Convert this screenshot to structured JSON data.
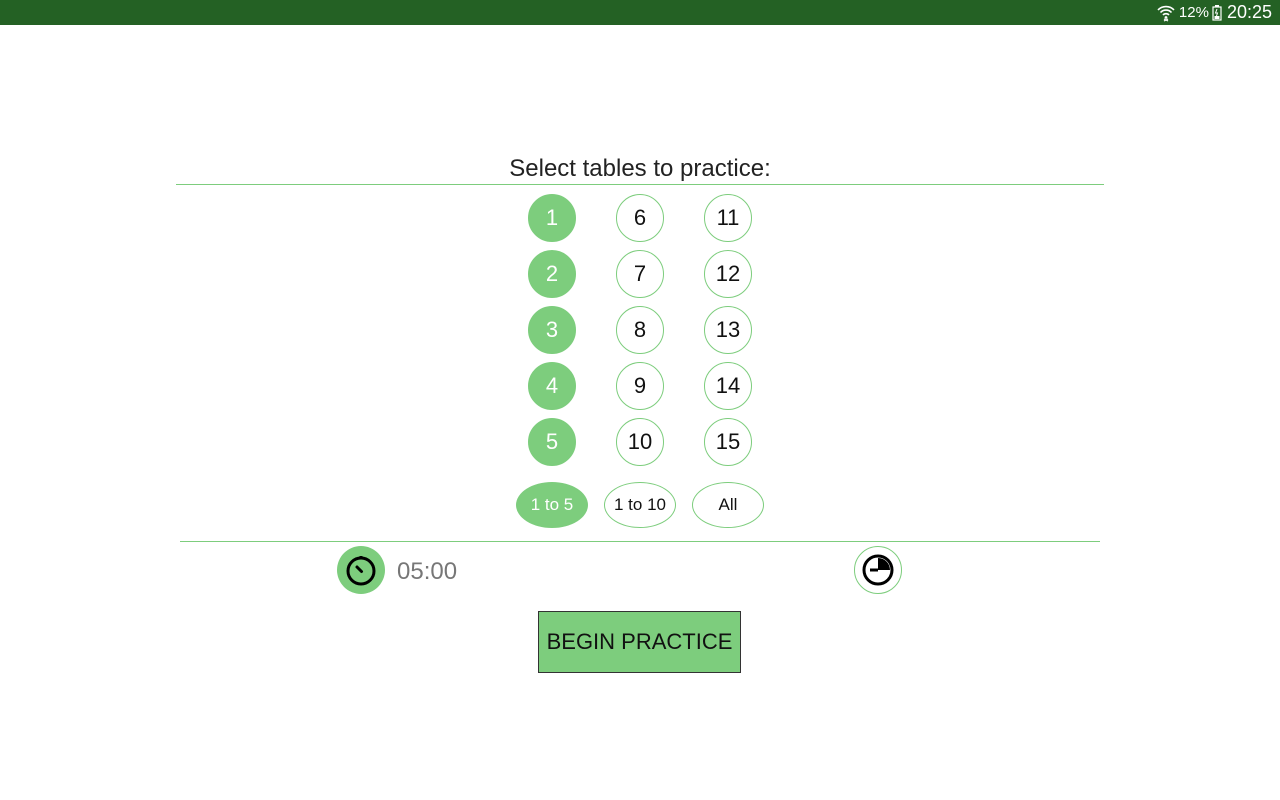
{
  "status_bar": {
    "battery_percent": "12%",
    "time": "20:25",
    "icons": [
      "wifi-icon",
      "battery-icon"
    ]
  },
  "title": "Select tables to practice:",
  "tables": [
    {
      "label": "1",
      "selected": true
    },
    {
      "label": "2",
      "selected": true
    },
    {
      "label": "3",
      "selected": true
    },
    {
      "label": "4",
      "selected": true
    },
    {
      "label": "5",
      "selected": true
    },
    {
      "label": "6",
      "selected": false
    },
    {
      "label": "7",
      "selected": false
    },
    {
      "label": "8",
      "selected": false
    },
    {
      "label": "9",
      "selected": false
    },
    {
      "label": "10",
      "selected": false
    },
    {
      "label": "11",
      "selected": false
    },
    {
      "label": "12",
      "selected": false
    },
    {
      "label": "13",
      "selected": false
    },
    {
      "label": "14",
      "selected": false
    },
    {
      "label": "15",
      "selected": false
    }
  ],
  "ranges": [
    {
      "label": "1 to 5",
      "selected": true
    },
    {
      "label": "1 to 10",
      "selected": false
    },
    {
      "label": "All",
      "selected": false
    }
  ],
  "timer": {
    "value": "05:00",
    "icon": "stopwatch-icon"
  },
  "pie_icon": "pie-chart-icon",
  "begin_label": "BEGIN PRACTICE",
  "colors": {
    "status_bar": "#246124",
    "accent": "#7dcd7d"
  }
}
